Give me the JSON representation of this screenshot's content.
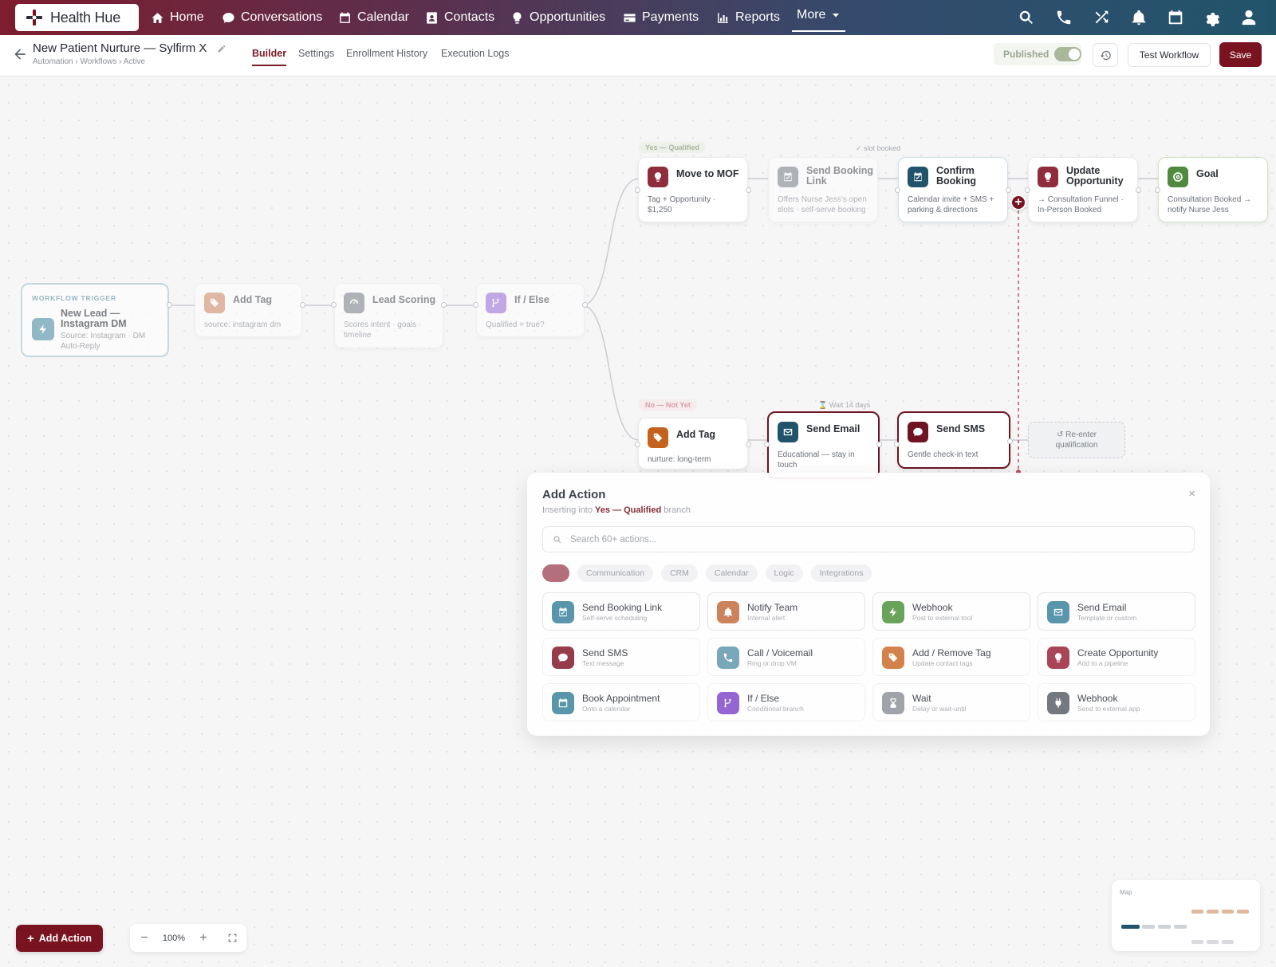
{
  "nav": {
    "brand": "Health Hue",
    "items": [
      {
        "label": "Home",
        "icon": "home-icon"
      },
      {
        "label": "Conversations",
        "icon": "chat-icon"
      },
      {
        "label": "Calendar",
        "icon": "calendar-icon"
      },
      {
        "label": "Contacts",
        "icon": "contact-card-icon"
      },
      {
        "label": "Opportunities",
        "icon": "lightbulb-icon"
      },
      {
        "label": "Payments",
        "icon": "credit-card-icon"
      },
      {
        "label": "Reports",
        "icon": "bar-chart-icon"
      },
      {
        "label": "More",
        "icon": "caret-down-icon"
      }
    ],
    "utilities": [
      "search-icon",
      "phone-icon",
      "shuffle-icon",
      "bell-icon",
      "calendar-icon",
      "gear-icon",
      "user-icon"
    ]
  },
  "workflow": {
    "title": "New Patient Nurture — Sylfirm X",
    "breadcrumb": "Automation › Workflows › Active",
    "tabs": [
      "Builder",
      "Settings",
      "Enrollment History",
      "Execution Logs"
    ],
    "active_tab": "Builder",
    "status_label": "Published",
    "published": true,
    "test_label": "Test Workflow",
    "save_label": "Save"
  },
  "trigger": {
    "label": "WORKFLOW TRIGGER",
    "title_1": "New Lead —",
    "title_2": "Instagram DM",
    "desc_1": "Source: Instagram · DM",
    "desc_2": "Auto-Reply"
  },
  "nodes": {
    "add_tag_1": {
      "title": "Add Tag",
      "desc": "source: instagram dm"
    },
    "lead_scoring": {
      "title": "Lead Scoring",
      "desc_1": "Scores intent · goals ·",
      "desc_2": "timeline"
    },
    "if_else": {
      "title": "If / Else",
      "desc": "Qualified = true?"
    },
    "move_mof": {
      "title": "Move to MOF",
      "desc_1": "Tag + Opportunity ·",
      "desc_2": "$1,250"
    },
    "send_booking": {
      "title_1": "Send Booking",
      "title_2": "Link",
      "desc_1": "Offers Nurse Jess's open",
      "desc_2": "slots · self-serve booking"
    },
    "confirm_booking": {
      "title_1": "Confirm",
      "title_2": "Booking",
      "desc_1": "Calendar invite + SMS +",
      "desc_2": "parking & directions"
    },
    "update_opp": {
      "title_1": "Update",
      "title_2": "Opportunity",
      "desc_1": "→ Consultation Funnel ·",
      "desc_2": "In-Person Booked"
    },
    "goal": {
      "title": "Goal",
      "desc_1": "Consultation Booked →",
      "desc_2": "notify Nurse Jess"
    },
    "add_tag_2": {
      "title": "Add Tag",
      "desc": "nurture: long-term"
    },
    "send_email": {
      "title": "Send Email",
      "desc_1": "Educational — stay in",
      "desc_2": "touch"
    },
    "send_sms": {
      "title": "Send SMS",
      "desc": "Gentle check-in text"
    },
    "reenter": {
      "line_1": "↺ Re-enter",
      "line_2": "qualification"
    }
  },
  "branches": {
    "yes": "Yes — Qualified",
    "no": "No — Not Yet",
    "slot_booked": "✓ slot booked",
    "wait": "⌛ Wait 14 days"
  },
  "panel": {
    "title": "Add Action",
    "sub_pre": "Inserting into",
    "sub_branch": "Yes — Qualified",
    "sub_post": "branch",
    "close": "×",
    "search_placeholder": "Search 60+ actions...",
    "chips": [
      "Communication",
      "CRM",
      "Calendar",
      "Logic",
      "Integrations"
    ],
    "actions": [
      {
        "title": "Send Booking Link",
        "desc": "Self-serve scheduling",
        "icon": "calendar-check-icon",
        "color": "#4e8fa6"
      },
      {
        "title": "Notify Team",
        "desc": "Internal alert",
        "icon": "bell-icon",
        "color": "#c97a4f"
      },
      {
        "title": "Webhook",
        "desc": "Post to external tool",
        "icon": "bolt-icon",
        "color": "#5f9e4f"
      },
      {
        "title": "Send Email",
        "desc": "Template or custom",
        "icon": "envelope-icon",
        "color": "#4e8fa6"
      },
      {
        "title": "Send SMS",
        "desc": "Text message",
        "icon": "chat-bubble-icon",
        "color": "#8f2d3d"
      },
      {
        "title": "Call / Voicemail",
        "desc": "Ring or drop VM",
        "icon": "phone-icon",
        "color": "#6fa3b5"
      },
      {
        "title": "Add / Remove Tag",
        "desc": "Update contact tags",
        "icon": "tag-icon",
        "color": "#d17a3e"
      },
      {
        "title": "Create Opportunity",
        "desc": "Add to a pipeline",
        "icon": "lightbulb-icon",
        "color": "#a5384b"
      },
      {
        "title": "Book Appointment",
        "desc": "Onto a calendar",
        "icon": "calendar-icon",
        "color": "#4e8fa6"
      },
      {
        "title": "If / Else",
        "desc": "Conditional branch",
        "icon": "branch-icon",
        "color": "#8e5bd0"
      },
      {
        "title": "Wait",
        "desc": "Delay or wait-until",
        "icon": "hourglass-icon",
        "color": "#9a9ea5"
      },
      {
        "title": "Webhook",
        "desc": "Send to external app",
        "icon": "plug-icon",
        "color": "#6b7078"
      }
    ]
  },
  "bottom": {
    "add_action": "Add Action",
    "zoom": "100%",
    "minimap_label": "Map"
  },
  "colors": {
    "brand": "#7a1320",
    "teal": "#21546b",
    "accent_green": "#5f9e4f"
  }
}
